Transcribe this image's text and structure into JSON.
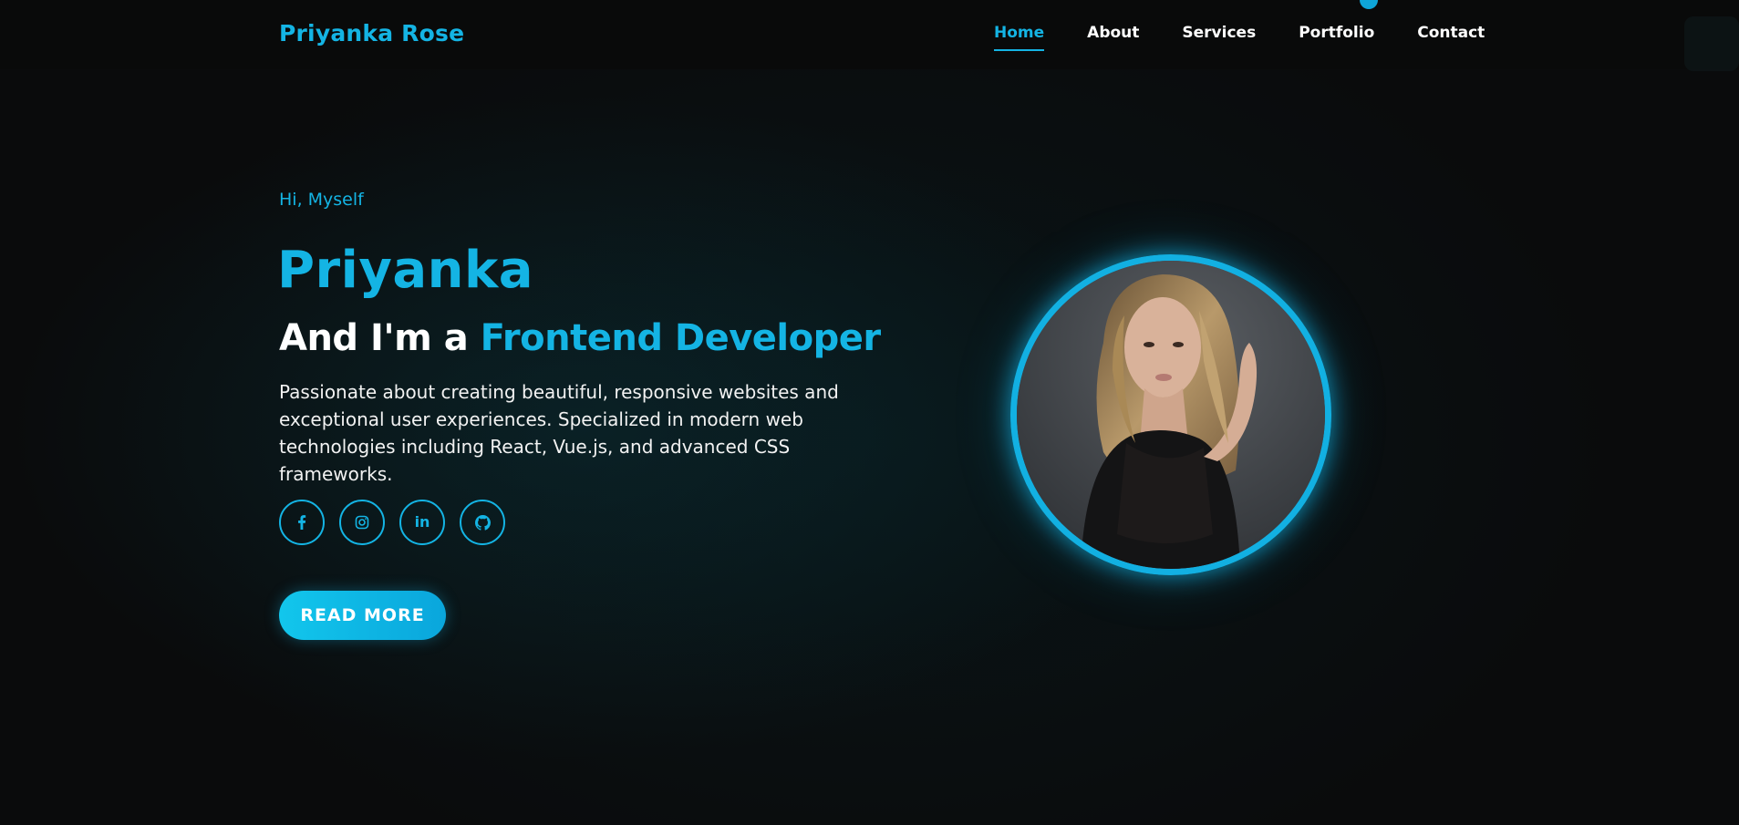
{
  "brand": {
    "logo": "Priyanka Rose"
  },
  "nav": {
    "items": [
      {
        "label": "Home",
        "active": true
      },
      {
        "label": "About",
        "active": false
      },
      {
        "label": "Services",
        "active": false
      },
      {
        "label": "Portfolio",
        "active": false
      },
      {
        "label": "Contact",
        "active": false
      }
    ]
  },
  "hero": {
    "greeting": "Hi, Myself",
    "name": "Priyanka",
    "role_prefix": "And I'm a",
    "role_accent": "Frontend Developer",
    "description": "Passionate about creating beautiful, responsive websites and exceptional user experiences. Specialized in modern web technologies including React, Vue.js, and advanced CSS frameworks.",
    "cta_label": "READ MORE"
  },
  "social": {
    "items": [
      {
        "icon": "facebook-icon"
      },
      {
        "icon": "instagram-icon"
      },
      {
        "icon": "linkedin-icon",
        "glyph": "in"
      },
      {
        "icon": "github-icon"
      }
    ]
  },
  "profile": {
    "icon": "profile-photo"
  },
  "colors": {
    "accent": "#14b4e4",
    "background": "#0a0b0c",
    "text": "#ffffff"
  }
}
